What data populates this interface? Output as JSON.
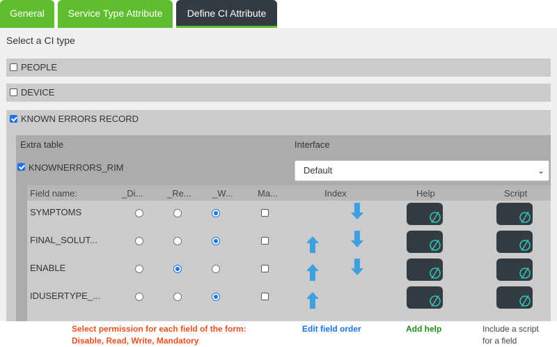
{
  "tabs": [
    {
      "label": "General"
    },
    {
      "label": "Service Type Attribute"
    },
    {
      "label": "Define CI Attribute"
    }
  ],
  "select_label": "Select a CI type",
  "ci_types": [
    {
      "label": "PEOPLE",
      "checked": false
    },
    {
      "label": "DEVICE",
      "checked": false
    },
    {
      "label": "KNOWN ERRORS RECORD",
      "checked": true
    }
  ],
  "ci_detail": {
    "extra_table_header": "Extra table",
    "interface_header": "Interface",
    "table_name": "KNOWNERRORS_RIM",
    "table_checked": true,
    "interface_value": "Default",
    "columns": {
      "field_name": "Field name:",
      "disable": "_Di...",
      "read": "_Re...",
      "write": "_W...",
      "mandatory": "Ma...",
      "index": "Index",
      "help": "Help",
      "script": "Script"
    },
    "fields": [
      {
        "name": "SYMPTOMS",
        "permission": "write",
        "mandatory": false,
        "up": false,
        "down": true
      },
      {
        "name": "FINAL_SOLUT...",
        "permission": "write",
        "mandatory": false,
        "up": true,
        "down": true
      },
      {
        "name": "ENABLE",
        "permission": "read",
        "mandatory": false,
        "up": true,
        "down": true
      },
      {
        "name": "IDUSERTYPE_...",
        "permission": "write",
        "mandatory": false,
        "up": true,
        "down": false
      }
    ]
  },
  "annotations": {
    "permissions_line1": "Select permission for each field of the form:",
    "permissions_line2": "Disable, Read, Write, Mandatory",
    "order": "Edit field order",
    "help": "Add help",
    "script_line1": "Include a script",
    "script_line2": "for a field"
  },
  "colors": {
    "tab_green": "#5fbe2d",
    "tab_dark": "#333c43",
    "radio_blue": "#1a73e8",
    "arrow_blue": "#3fa0e0",
    "icon_teal": "#36c2b4",
    "annot_red": "#e8501e",
    "annot_blue": "#1a73e8",
    "annot_green": "#1e8c1e"
  }
}
